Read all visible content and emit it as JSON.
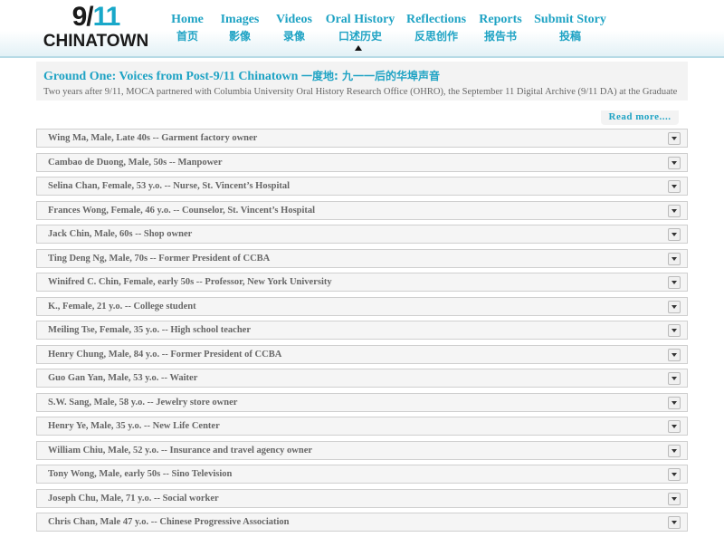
{
  "logo": {
    "num_a": "9/",
    "num_b": "11",
    "name": "CHINATOWN"
  },
  "nav": [
    {
      "en": "Home",
      "zh": "首页"
    },
    {
      "en": "Images",
      "zh": "影像"
    },
    {
      "en": "Videos",
      "zh": "录像"
    },
    {
      "en": "Oral History",
      "zh": "口述历史",
      "active": true
    },
    {
      "en": "Reflections",
      "zh": "反思创作"
    },
    {
      "en": "Reports",
      "zh": "报告书"
    },
    {
      "en": "Submit Story",
      "zh": "投稿"
    }
  ],
  "intro": {
    "title": "Ground One: Voices from Post-9/11 Chinatown",
    "title_zh": "一度地: 九一一后的华埠声音",
    "text": "Two years after 9/11, MOCA partnered with Columbia University Oral History Research Office (OHRO), the September 11 Digital Archive (9/11 DA) at the Graduate",
    "read_more": "Read more...."
  },
  "interviews": [
    "Wing Ma, Male, Late 40s -- Garment factory owner",
    "Cambao de Duong, Male, 50s -- Manpower",
    "Selina Chan, Female, 53 y.o. -- Nurse, St. Vincent’s Hospital",
    "Frances Wong, Female, 46 y.o. -- Counselor, St. Vincent’s Hospital",
    "Jack Chin, Male, 60s -- Shop owner",
    "Ting Deng Ng, Male, 70s -- Former President of CCBA",
    "Winifred C. Chin, Female, early 50s -- Professor, New York University",
    "K., Female, 21 y.o. -- College student",
    "Meiling Tse, Female, 35 y.o. -- High school teacher",
    "Henry Chung, Male, 84 y.o. -- Former President of CCBA",
    "Guo Gan Yan, Male, 53 y.o. -- Waiter",
    "S.W. Sang, Male, 58 y.o. -- Jewelry store owner",
    "Henry Ye, Male, 35 y.o. -- New Life Center",
    "William Chiu, Male, 52 y.o. -- Insurance and travel agency owner",
    "Tony Wong, Male, early 50s -- Sino Television",
    "Joseph Chu, Male, 71 y.o. -- Social worker",
    "Chris Chan, Male 47 y.o. -- Chinese Progressive Association"
  ],
  "colors": {
    "accent": "#1fa3c4"
  }
}
